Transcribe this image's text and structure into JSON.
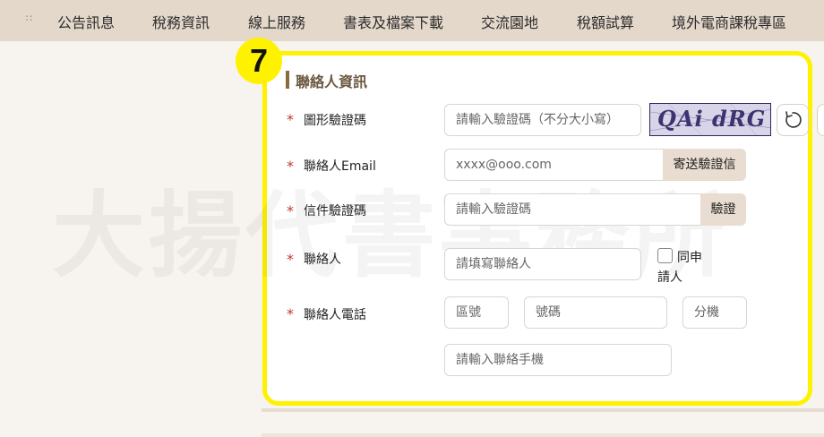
{
  "nav": {
    "handle": "∷",
    "items": [
      "公告訊息",
      "稅務資訊",
      "線上服務",
      "書表及檔案下載",
      "交流園地",
      "稅額試算",
      "境外電商課稅專區"
    ]
  },
  "watermark": "大揚代書事務所",
  "step_badge": "7",
  "section_title": "聯絡人資訊",
  "required_mark": "*",
  "form": {
    "captcha": {
      "label": "圖形驗證碼",
      "placeholder": "請輸入驗證碼（不分大小寫）",
      "image_text": "QAi dRG",
      "refresh_icon": "refresh-icon"
    },
    "email": {
      "label": "聯絡人Email",
      "placeholder": "xxxx@ooo.com",
      "button": "寄送驗證信"
    },
    "letter_code": {
      "label": "信件驗證碼",
      "placeholder": "請輸入驗證碼",
      "button": "驗證"
    },
    "contact": {
      "label": "聯絡人",
      "placeholder": "請填寫聯絡人",
      "same_as_applicant_line1": "同申",
      "same_as_applicant_line2": "請人",
      "same_as_applicant_checked": false
    },
    "phone": {
      "label": "聯絡人電話",
      "area_placeholder": "區號",
      "number_placeholder": "號碼",
      "ext_placeholder": "分機",
      "mobile_placeholder": "請輸入聯絡手機"
    }
  },
  "colors": {
    "nav_bg": "#e4d8cb",
    "highlight": "#fff200",
    "accent_brown": "#8b6a3e",
    "required_red": "#c0392b",
    "button_bg": "#e8ddd0"
  }
}
